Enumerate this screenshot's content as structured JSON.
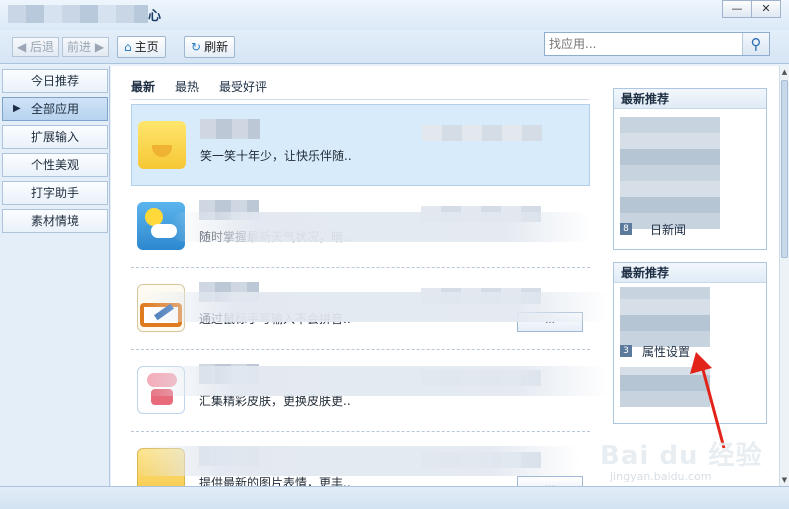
{
  "window": {
    "title_visible": "心",
    "minimize": "—",
    "close": "✕"
  },
  "toolbar": {
    "back": "◀ 后退",
    "forward": "前进 ▶",
    "home": "主页",
    "refresh": "刷新",
    "search_placeholder": "找应用..."
  },
  "sidebar": {
    "items": [
      {
        "label": "今日推荐"
      },
      {
        "label": "全部应用"
      },
      {
        "label": "扩展输入"
      },
      {
        "label": "个性美观"
      },
      {
        "label": "打字助手"
      },
      {
        "label": "素材情境"
      }
    ],
    "active_index": 1
  },
  "tabs": [
    "最新",
    "最热",
    "最受好评"
  ],
  "apps": [
    {
      "icon": "yellow-app-icon",
      "desc": "笑一笑十年少，让快乐伴随.."
    },
    {
      "icon": "weather-icon",
      "desc": "随时掌握最新天气状况，暗.."
    },
    {
      "icon": "handwriting-icon",
      "desc": "通过鼠标手写输入不会拼音..",
      "button": "..."
    },
    {
      "icon": "skin-icon",
      "desc": "汇集精彩皮肤，更换皮肤更.."
    },
    {
      "icon": "emoji-icon",
      "desc": "提供最新的图片表情，更丰..",
      "button": "..."
    }
  ],
  "panels": {
    "latest": {
      "title": "最新推荐",
      "visible_item": {
        "num": "8",
        "label": "日新闻"
      }
    },
    "hot": {
      "title": "最新推荐",
      "items": [
        {
          "num": "3",
          "label": "属性设置"
        }
      ]
    }
  },
  "watermark": {
    "text": "Bai du 经验",
    "sub": "jingyan.baidu.com"
  },
  "colors": {
    "accent": "#2d7ec9",
    "arrow": "#e2231a",
    "highlight_row": "#d8ebfa"
  }
}
